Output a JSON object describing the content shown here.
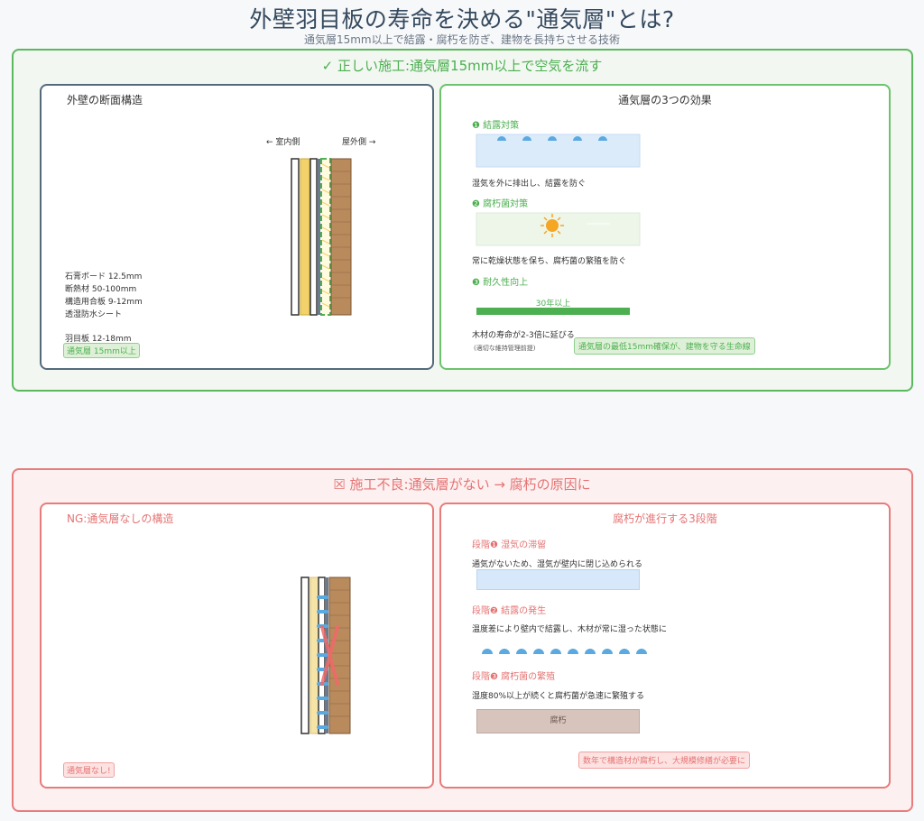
{
  "header": {
    "title": "外壁羽目板の寿命を決める\"通気層\"とは?",
    "subtitle": "通気層15mm以上で結露・腐朽を防ぎ、建物を長持ちさせる技術"
  },
  "good": {
    "section_title": "✓ 正しい施工:通気層15mm以上で空気を流す",
    "structure": {
      "title": "外壁の断面構造",
      "indoor_label": "← 室内側",
      "outdoor_label": "屋外側 →",
      "layers": [
        "石膏ボード 12.5mm",
        "断熱材 50-100mm",
        "構造用合板 9-12mm",
        "透湿防水シート"
      ],
      "siding": "羽目板 12-18mm",
      "gap_badge": "通気層 15mm以上"
    },
    "effects": {
      "title": "通気層の3つの効果",
      "items": [
        {
          "head": "❶ 結露対策",
          "desc": "湿気を外に排出し、結露を防ぐ"
        },
        {
          "head": "❷ 腐朽菌対策",
          "desc": "常に乾燥状態を保ち、腐朽菌の繁殖を防ぐ"
        },
        {
          "head": "❸ 耐久性向上",
          "bar_label": "30年以上",
          "desc": "木材の寿命が2-3倍に延びる",
          "note": "(適切な維持管理前提)"
        }
      ],
      "badge": "通気層の最低15mm確保が、建物を守る生命線"
    }
  },
  "bad": {
    "section_title": "☒ 施工不良:通気層がない → 腐朽の原因に",
    "structure": {
      "title": "NG:通気層なしの構造",
      "badge": "通気層なし!"
    },
    "stages": {
      "title": "腐朽が進行する3段階",
      "items": [
        {
          "head": "段階❶ 湿気の滞留",
          "desc": "通気がないため、湿気が壁内に閉じ込められる"
        },
        {
          "head": "段階❷ 結露の発生",
          "desc": "温度差により壁内で結露し、木材が常に湿った状態に"
        },
        {
          "head": "段階❸ 腐朽菌の繁殖",
          "desc": "湿度80%以上が続くと腐朽菌が急速に繁殖する",
          "box_label": "腐朽"
        }
      ],
      "badge": "数年で構造材が腐朽し、大規模修繕が必要に"
    }
  },
  "colors": {
    "good": "#4caf50",
    "bad": "#e57373",
    "wood": "#b98a5c",
    "insulation": "#f3d26b",
    "moisture": "#5aa9e0"
  }
}
